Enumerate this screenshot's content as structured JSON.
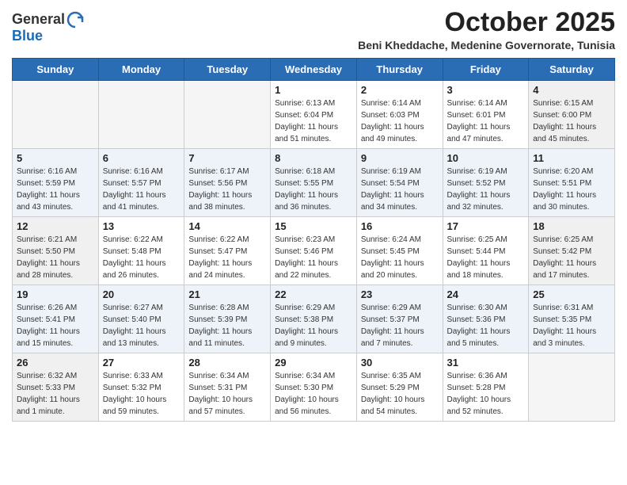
{
  "header": {
    "logo_general": "General",
    "logo_blue": "Blue",
    "month_year": "October 2025",
    "location": "Beni Kheddache, Medenine Governorate, Tunisia"
  },
  "weekdays": [
    "Sunday",
    "Monday",
    "Tuesday",
    "Wednesday",
    "Thursday",
    "Friday",
    "Saturday"
  ],
  "weeks": [
    [
      {
        "day": "",
        "detail": ""
      },
      {
        "day": "",
        "detail": ""
      },
      {
        "day": "",
        "detail": ""
      },
      {
        "day": "1",
        "detail": "Sunrise: 6:13 AM\nSunset: 6:04 PM\nDaylight: 11 hours\nand 51 minutes."
      },
      {
        "day": "2",
        "detail": "Sunrise: 6:14 AM\nSunset: 6:03 PM\nDaylight: 11 hours\nand 49 minutes."
      },
      {
        "day": "3",
        "detail": "Sunrise: 6:14 AM\nSunset: 6:01 PM\nDaylight: 11 hours\nand 47 minutes."
      },
      {
        "day": "4",
        "detail": "Sunrise: 6:15 AM\nSunset: 6:00 PM\nDaylight: 11 hours\nand 45 minutes."
      }
    ],
    [
      {
        "day": "5",
        "detail": "Sunrise: 6:16 AM\nSunset: 5:59 PM\nDaylight: 11 hours\nand 43 minutes."
      },
      {
        "day": "6",
        "detail": "Sunrise: 6:16 AM\nSunset: 5:57 PM\nDaylight: 11 hours\nand 41 minutes."
      },
      {
        "day": "7",
        "detail": "Sunrise: 6:17 AM\nSunset: 5:56 PM\nDaylight: 11 hours\nand 38 minutes."
      },
      {
        "day": "8",
        "detail": "Sunrise: 6:18 AM\nSunset: 5:55 PM\nDaylight: 11 hours\nand 36 minutes."
      },
      {
        "day": "9",
        "detail": "Sunrise: 6:19 AM\nSunset: 5:54 PM\nDaylight: 11 hours\nand 34 minutes."
      },
      {
        "day": "10",
        "detail": "Sunrise: 6:19 AM\nSunset: 5:52 PM\nDaylight: 11 hours\nand 32 minutes."
      },
      {
        "day": "11",
        "detail": "Sunrise: 6:20 AM\nSunset: 5:51 PM\nDaylight: 11 hours\nand 30 minutes."
      }
    ],
    [
      {
        "day": "12",
        "detail": "Sunrise: 6:21 AM\nSunset: 5:50 PM\nDaylight: 11 hours\nand 28 minutes."
      },
      {
        "day": "13",
        "detail": "Sunrise: 6:22 AM\nSunset: 5:48 PM\nDaylight: 11 hours\nand 26 minutes."
      },
      {
        "day": "14",
        "detail": "Sunrise: 6:22 AM\nSunset: 5:47 PM\nDaylight: 11 hours\nand 24 minutes."
      },
      {
        "day": "15",
        "detail": "Sunrise: 6:23 AM\nSunset: 5:46 PM\nDaylight: 11 hours\nand 22 minutes."
      },
      {
        "day": "16",
        "detail": "Sunrise: 6:24 AM\nSunset: 5:45 PM\nDaylight: 11 hours\nand 20 minutes."
      },
      {
        "day": "17",
        "detail": "Sunrise: 6:25 AM\nSunset: 5:44 PM\nDaylight: 11 hours\nand 18 minutes."
      },
      {
        "day": "18",
        "detail": "Sunrise: 6:25 AM\nSunset: 5:42 PM\nDaylight: 11 hours\nand 17 minutes."
      }
    ],
    [
      {
        "day": "19",
        "detail": "Sunrise: 6:26 AM\nSunset: 5:41 PM\nDaylight: 11 hours\nand 15 minutes."
      },
      {
        "day": "20",
        "detail": "Sunrise: 6:27 AM\nSunset: 5:40 PM\nDaylight: 11 hours\nand 13 minutes."
      },
      {
        "day": "21",
        "detail": "Sunrise: 6:28 AM\nSunset: 5:39 PM\nDaylight: 11 hours\nand 11 minutes."
      },
      {
        "day": "22",
        "detail": "Sunrise: 6:29 AM\nSunset: 5:38 PM\nDaylight: 11 hours\nand 9 minutes."
      },
      {
        "day": "23",
        "detail": "Sunrise: 6:29 AM\nSunset: 5:37 PM\nDaylight: 11 hours\nand 7 minutes."
      },
      {
        "day": "24",
        "detail": "Sunrise: 6:30 AM\nSunset: 5:36 PM\nDaylight: 11 hours\nand 5 minutes."
      },
      {
        "day": "25",
        "detail": "Sunrise: 6:31 AM\nSunset: 5:35 PM\nDaylight: 11 hours\nand 3 minutes."
      }
    ],
    [
      {
        "day": "26",
        "detail": "Sunrise: 6:32 AM\nSunset: 5:33 PM\nDaylight: 11 hours\nand 1 minute."
      },
      {
        "day": "27",
        "detail": "Sunrise: 6:33 AM\nSunset: 5:32 PM\nDaylight: 10 hours\nand 59 minutes."
      },
      {
        "day": "28",
        "detail": "Sunrise: 6:34 AM\nSunset: 5:31 PM\nDaylight: 10 hours\nand 57 minutes."
      },
      {
        "day": "29",
        "detail": "Sunrise: 6:34 AM\nSunset: 5:30 PM\nDaylight: 10 hours\nand 56 minutes."
      },
      {
        "day": "30",
        "detail": "Sunrise: 6:35 AM\nSunset: 5:29 PM\nDaylight: 10 hours\nand 54 minutes."
      },
      {
        "day": "31",
        "detail": "Sunrise: 6:36 AM\nSunset: 5:28 PM\nDaylight: 10 hours\nand 52 minutes."
      },
      {
        "day": "",
        "detail": ""
      }
    ]
  ]
}
